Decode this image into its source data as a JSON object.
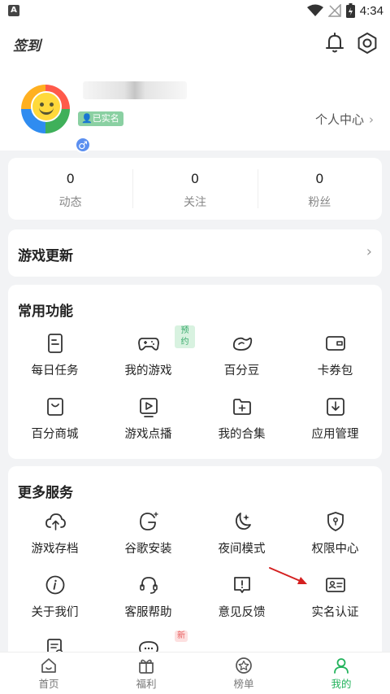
{
  "status_bar": {
    "time": "4:34",
    "notification_letter": "A"
  },
  "top_bar": {
    "title": "签到"
  },
  "profile": {
    "verified_label": "已实名",
    "personal_center": "个人中心"
  },
  "stats": [
    {
      "value": "0",
      "label": "动态"
    },
    {
      "value": "0",
      "label": "关注"
    },
    {
      "value": "0",
      "label": "粉丝"
    }
  ],
  "game_update": {
    "title": "游戏更新"
  },
  "common_functions": {
    "title": "常用功能",
    "items": [
      {
        "label": "每日任务",
        "icon": "daily-task-icon"
      },
      {
        "label": "我的游戏",
        "icon": "gamepad-icon",
        "tag": "预约"
      },
      {
        "label": "百分豆",
        "icon": "bean-icon"
      },
      {
        "label": "卡券包",
        "icon": "wallet-icon"
      },
      {
        "label": "百分商城",
        "icon": "shopping-bag-icon"
      },
      {
        "label": "游戏点播",
        "icon": "play-video-icon"
      },
      {
        "label": "我的合集",
        "icon": "folder-add-icon"
      },
      {
        "label": "应用管理",
        "icon": "download-box-icon"
      }
    ]
  },
  "more_services": {
    "title": "更多服务",
    "items": [
      {
        "label": "游戏存档",
        "icon": "cloud-upload-icon"
      },
      {
        "label": "谷歌安装",
        "icon": "google-install-icon"
      },
      {
        "label": "夜间模式",
        "icon": "moon-icon"
      },
      {
        "label": "权限中心",
        "icon": "shield-icon"
      },
      {
        "label": "关于我们",
        "icon": "info-icon"
      },
      {
        "label": "客服帮助",
        "icon": "headset-icon"
      },
      {
        "label": "意见反馈",
        "icon": "feedback-icon"
      },
      {
        "label": "实名认证",
        "icon": "id-card-icon"
      },
      {
        "label": "",
        "icon": "document-icon"
      },
      {
        "label": "",
        "icon": "chat-icon",
        "tag": "新"
      }
    ]
  },
  "bottom_nav": [
    {
      "label": "首页",
      "icon": "home-icon"
    },
    {
      "label": "福利",
      "icon": "gift-icon"
    },
    {
      "label": "榜单",
      "icon": "star-badge-icon"
    },
    {
      "label": "我的",
      "icon": "user-icon",
      "active": true
    }
  ],
  "colors": {
    "accent": "#23b35c",
    "icon_stroke": "#333333",
    "annotation_arrow": "#d42020"
  }
}
